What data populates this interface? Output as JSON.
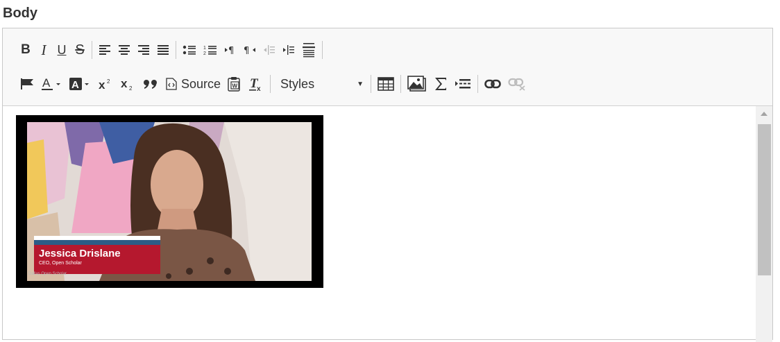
{
  "field": {
    "label": "Body"
  },
  "toolbar": {
    "source_label": "Source",
    "styles_label": "Styles",
    "row1": [
      "bold",
      "italic",
      "underline",
      "strikethrough",
      "align-left",
      "align-center",
      "align-right",
      "align-justify",
      "bulleted-list",
      "numbered-list",
      "ltr",
      "rtl",
      "outdent",
      "indent",
      "horizontal-rule"
    ],
    "row2": [
      "flag",
      "text-color",
      "background-color",
      "superscript",
      "subscript",
      "blockquote",
      "source",
      "paste-from-word",
      "remove-format",
      "styles",
      "table",
      "image",
      "math",
      "indent-block",
      "link",
      "unlink"
    ]
  },
  "video": {
    "name": "Jessica Drislane",
    "title": "CEO, Open Scholar",
    "strip": "Dallas Open Scholar",
    "colors": {
      "banner_red": "#b5182e",
      "banner_blue": "#2c5c86"
    }
  }
}
